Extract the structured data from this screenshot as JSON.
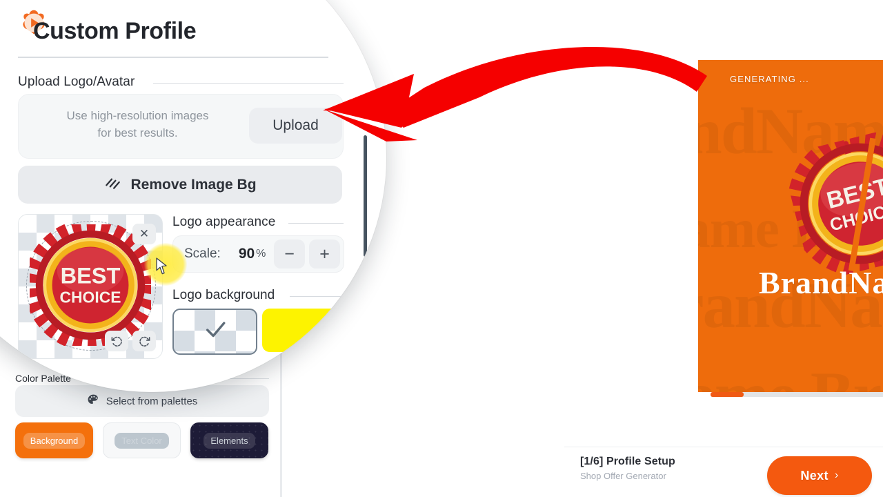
{
  "app": {
    "brand_logo_icon": "lion-play-logo",
    "panel_title": "Custom Profile"
  },
  "left_panel": {
    "sections": {
      "upload": {
        "label": "Upload Logo/Avatar",
        "hint_line1": "Use high-resolution images",
        "hint_line2": "for best results.",
        "upload_button": "Upload",
        "remove_bg_button": "Remove Image Bg",
        "remove_bg_icon": "diagonal-stripes-icon"
      },
      "logo_preview": {
        "close_icon": "close-icon",
        "rotate_left_icon": "rotate-left-icon",
        "rotate_right_icon": "rotate-right-icon",
        "image_alt": "BEST CHOICE badge",
        "badge_line1": "BEST",
        "badge_line2": "CHOICE"
      },
      "logo_appearance": {
        "label": "Logo appearance",
        "scale_label": "Scale:",
        "scale_value": "90",
        "scale_unit": "%",
        "decrement_icon": "minus-icon",
        "increment_icon": "plus-icon"
      },
      "logo_background": {
        "label": "Logo background",
        "options": [
          {
            "name": "transparent",
            "selected": true,
            "check_icon": "check-icon"
          },
          {
            "name": "yellow",
            "color": "#FDF300",
            "selected": false
          }
        ]
      },
      "color_palette": {
        "label": "Color Palette",
        "select_button": "Select from palettes",
        "palette_icon": "palette-icon",
        "chips": [
          {
            "label": "Background",
            "color": "#F4700C"
          },
          {
            "label": "Text Color",
            "color": "#F7F8F9"
          },
          {
            "label": "Elements",
            "color": "#1D1B37"
          }
        ]
      }
    }
  },
  "preview": {
    "status": "GENERATING ...",
    "background_color": "#EE6C0C",
    "watermark_text": "BrandName",
    "watermark_rows": [
      "BrandName Brand",
      "andName BrandName",
      "BrandName B",
      "ndName BrandNam"
    ],
    "title": "BrandName",
    "badge_line1": "BEST",
    "badge_line2": "CHOICE",
    "progress_percent": 10
  },
  "bottom_bar": {
    "step_index": "1",
    "step_total": "/6]",
    "step_prefix": "[",
    "step_title": "Profile Setup",
    "step_full": "[1/6] Profile Setup",
    "subtitle": "Shop Offer Generator",
    "next_label": "Next",
    "next_chevron": "›",
    "accent_color": "#F4590F"
  },
  "annotation": {
    "arrow_color": "#F50000",
    "arrow_points_to": "Upload",
    "cursor_icon": "mouse-pointer",
    "click_halo_color": "#FFEB3B"
  }
}
